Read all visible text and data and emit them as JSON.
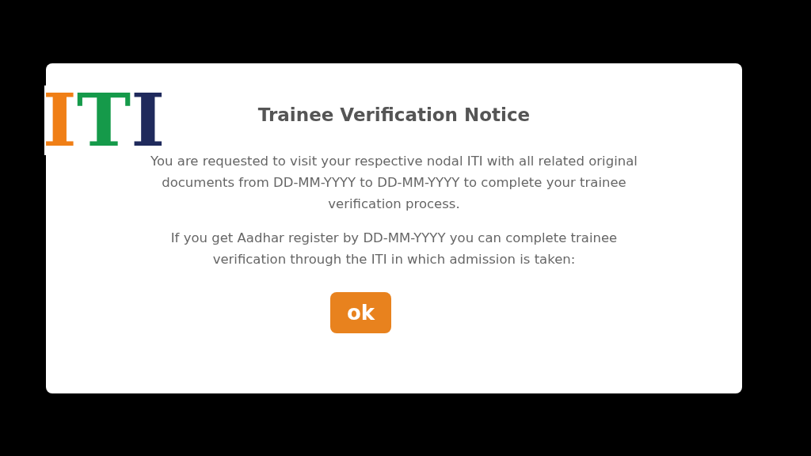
{
  "logo": {
    "letters": [
      {
        "text": "I",
        "color": "#f07f16"
      },
      {
        "text": "T",
        "color": "#159a4a"
      },
      {
        "text": "I",
        "color": "#1f2a5c"
      }
    ]
  },
  "dialog": {
    "title": "Trainee Verification Notice",
    "paragraphs": [
      "You are requested to visit your respective nodal ITI with all related original documents from DD-MM-YYYY to DD-MM-YYYY to complete your trainee verification process.",
      "If you get Aadhar register by DD-MM-YYYY you can complete trainee verification through the ITI in which admission is taken:"
    ],
    "button": "ok"
  }
}
